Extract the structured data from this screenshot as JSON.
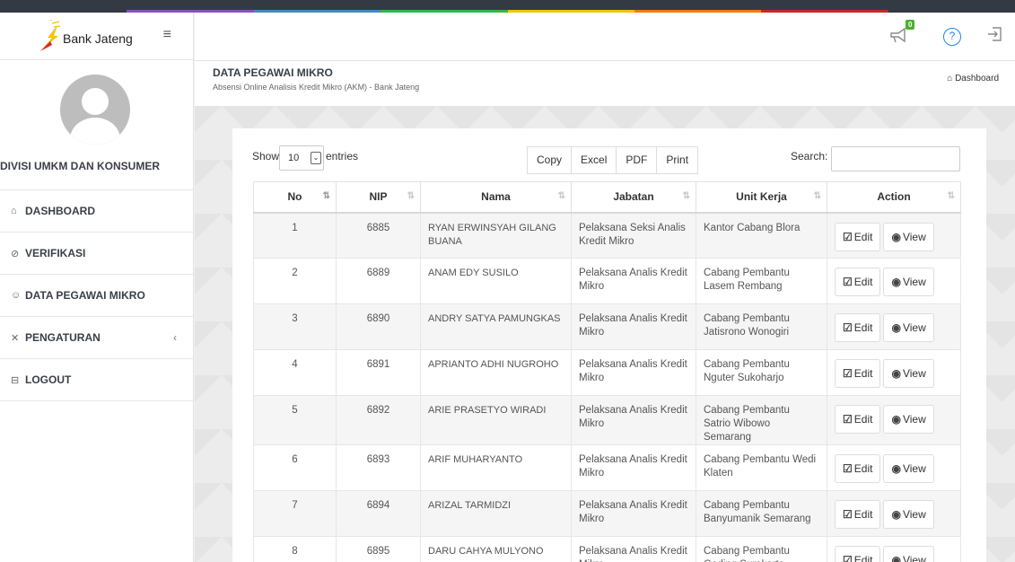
{
  "brand": {
    "name": "Bank Jateng",
    "logo_colors": [
      "#f5c400",
      "#d62828"
    ]
  },
  "topbar_colors": [
    "#333a44",
    "#8b4fc7",
    "#3c8dc4",
    "#33b54a",
    "#f3c300",
    "#ef7d14",
    "#c62828",
    "#333a44"
  ],
  "sidebar": {
    "profile_name": "DIVISI UMKM DAN KONSUMER",
    "items": [
      {
        "label": "DASHBOARD",
        "icon": "home-icon"
      },
      {
        "label": "VERIFIKASI",
        "icon": "check-circle-icon"
      },
      {
        "label": "DATA PEGAWAI MIKRO",
        "icon": "users-icon"
      },
      {
        "label": "PENGATURAN",
        "icon": "tools-icon"
      },
      {
        "label": "LOGOUT",
        "icon": "logout-icon"
      }
    ]
  },
  "header": {
    "notification_count": "0"
  },
  "page": {
    "title": "DATA PEGAWAI MIKRO",
    "subtitle": "Absensi Online Analisis Kredit Mikro (AKM) - Bank Jateng",
    "breadcrumb": "Dashboard"
  },
  "table_controls": {
    "show_label": "Show",
    "page_length": "10",
    "entries_label": "entries",
    "buttons": [
      "Copy",
      "Excel",
      "PDF",
      "Print"
    ],
    "search_label": "Search:"
  },
  "columns": [
    "No",
    "NIP",
    "Nama",
    "Jabatan",
    "Unit Kerja",
    "Action"
  ],
  "action_labels": {
    "edit": "Edit",
    "view": "View"
  },
  "rows": [
    {
      "no": "1",
      "nip": "6885",
      "nama": "RYAN ERWINSYAH GILANG BUANA",
      "jabatan": "Pelaksana Seksi Analis Kredit Mikro",
      "unit": "Kantor Cabang Blora"
    },
    {
      "no": "2",
      "nip": "6889",
      "nama": "ANAM EDY SUSILO",
      "jabatan": "Pelaksana Analis Kredit Mikro",
      "unit": "Cabang Pembantu Lasem Rembang"
    },
    {
      "no": "3",
      "nip": "6890",
      "nama": "ANDRY SATYA PAMUNGKAS",
      "jabatan": "Pelaksana Analis Kredit Mikro",
      "unit": "Cabang Pembantu Jatisrono Wonogiri"
    },
    {
      "no": "4",
      "nip": "6891",
      "nama": "APRIANTO ADHI NUGROHO",
      "jabatan": "Pelaksana Analis Kredit Mikro",
      "unit": "Cabang Pembantu Nguter Sukoharjo"
    },
    {
      "no": "5",
      "nip": "6892",
      "nama": "ARIE PRASETYO WIRADI",
      "jabatan": "Pelaksana Analis Kredit Mikro",
      "unit": "Cabang Pembantu Satrio Wibowo Semarang"
    },
    {
      "no": "6",
      "nip": "6893",
      "nama": "ARIF MUHARYANTO",
      "jabatan": "Pelaksana Analis Kredit Mikro",
      "unit": "Cabang Pembantu Wedi Klaten"
    },
    {
      "no": "7",
      "nip": "6894",
      "nama": "ARIZAL TARMIDZI",
      "jabatan": "Pelaksana Analis Kredit Mikro",
      "unit": "Cabang Pembantu Banyumanik Semarang"
    },
    {
      "no": "8",
      "nip": "6895",
      "nama": "DARU CAHYA MULYONO",
      "jabatan": "Pelaksana Analis Kredit Mikro",
      "unit": "Cabang Pembantu Gading Surakarta"
    }
  ]
}
